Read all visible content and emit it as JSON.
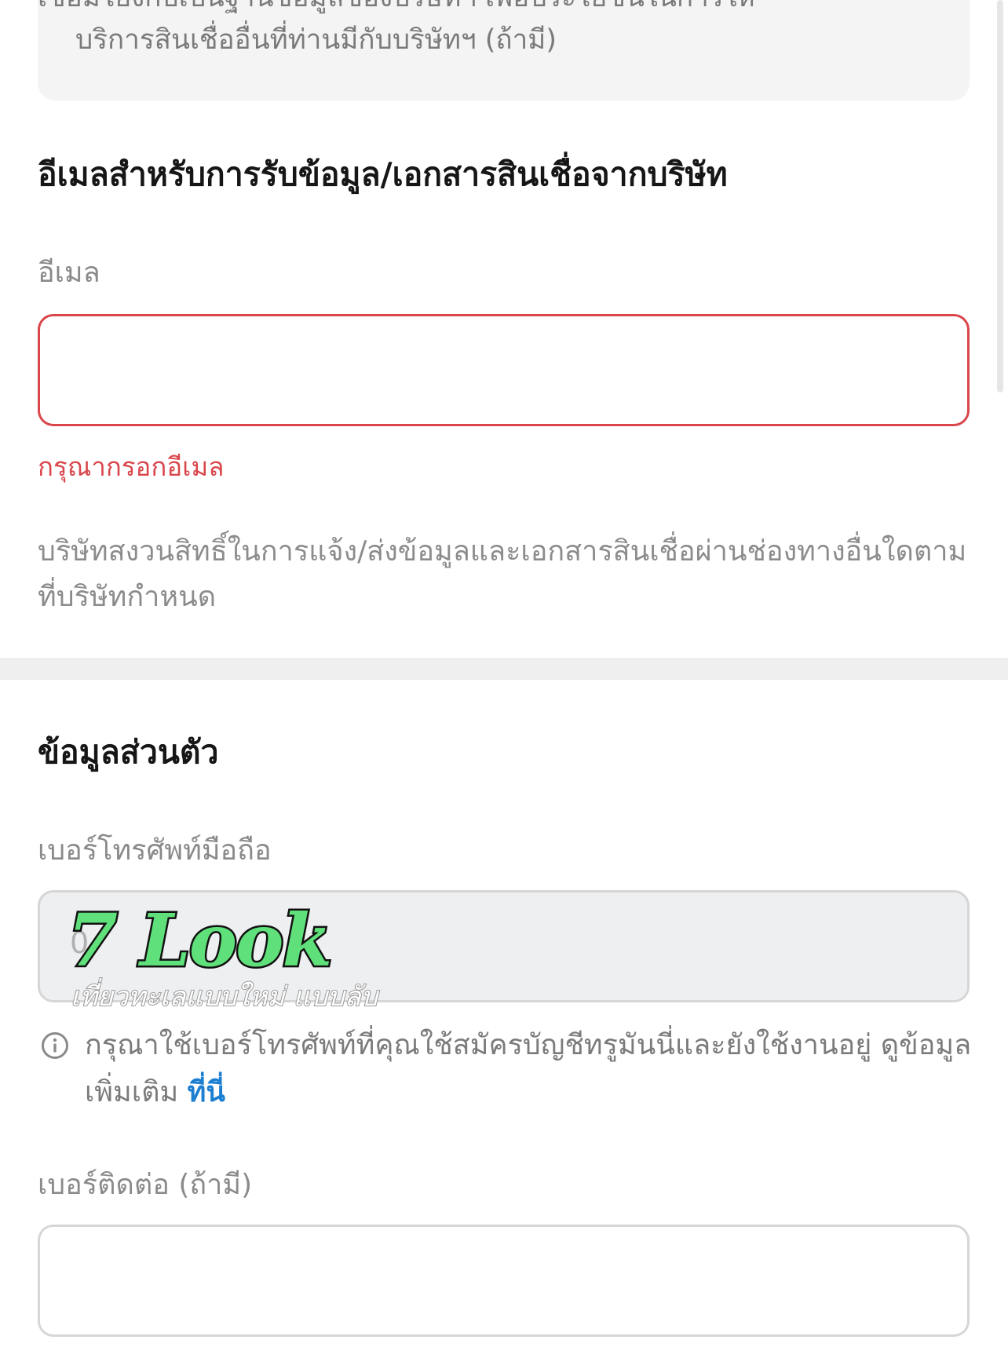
{
  "consent_box": {
    "line1": "เชื่อมโยงกับเป็นฐานข้อมูลของบริษัทฯ เพื่อประโยชน์ในการให้",
    "line2": "บริการสินเชื่ออื่นที่ท่านมีกับบริษัทฯ (ถ้ามี)"
  },
  "email_section": {
    "title": "อีเมลสำหรับการรับข้อมูล/เอกสารสินเชื่อจากบริษัท",
    "label": "อีเมล",
    "value": "",
    "error": "กรุณากรอกอีเมล",
    "note": "บริษัทสงวนสิทธิ์ในการแจ้ง/ส่งข้อมูลและเอกสารสินเชื่อผ่านช่องทางอื่นใดตามที่บริษัทกำหนด"
  },
  "personal_section": {
    "title": "ข้อมูลส่วนตัว",
    "mobile_label": "เบอร์โทรศัพท์มือถือ",
    "mobile_placeholder": "0",
    "info_text": "กรุณาใช้เบอร์โทรศัพท์ที่คุณใช้สมัครบัญชีทรูมันนี่และยังใช้งานอยู่ ดูข้อมูลเพิ่มเติม ",
    "info_link": "ที่นี่",
    "contact_label": "เบอร์ติดต่อ (ถ้ามี)",
    "contact_value": ""
  },
  "watermark": {
    "logo": "7 Look",
    "tagline": "เที่ยวทะเลแบบใหม่ แบบลับ"
  },
  "colors": {
    "error": "#d9464b",
    "link": "#1d7fd1",
    "logo_green": "#5fe07a"
  },
  "icons": [
    "info-icon"
  ]
}
